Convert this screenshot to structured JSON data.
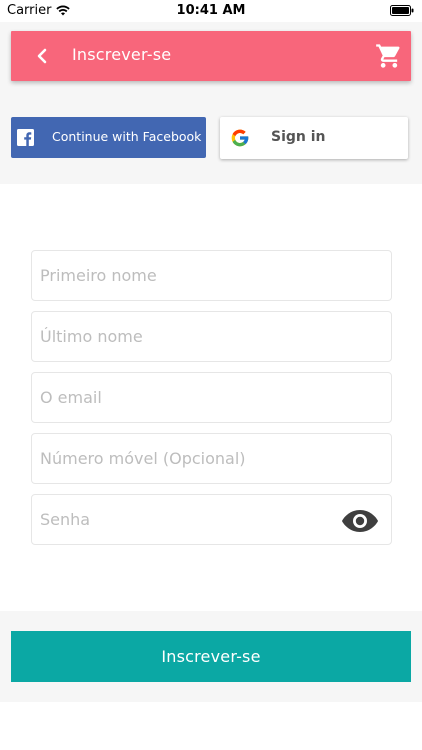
{
  "status_bar": {
    "carrier": "Carrier",
    "time": "10:41 AM",
    "wifi_icon": "wifi-icon",
    "battery_icon": "battery-icon"
  },
  "header": {
    "title": "Inscrever-se",
    "back_icon": "chevron-left-icon",
    "cart_icon": "cart-icon",
    "background_color": "#f8667b"
  },
  "social": {
    "facebook_label": "Continue with Facebook",
    "facebook_color": "#4267b2",
    "google_label": "Sign in"
  },
  "form": {
    "first_name_placeholder": "Primeiro nome",
    "last_name_placeholder": "Último nome",
    "email_placeholder": "O email",
    "phone_placeholder": "Número móvel (Opcional)",
    "password_placeholder": "Senha",
    "eye_icon": "eye-icon"
  },
  "submit": {
    "label": "Inscrever-se",
    "background_color": "#0ba8a4"
  }
}
